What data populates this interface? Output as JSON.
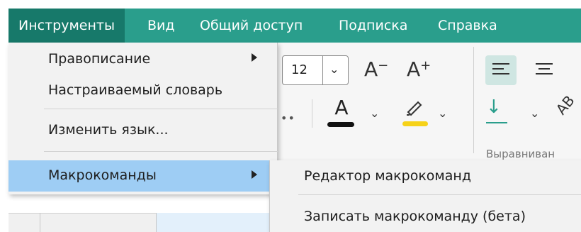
{
  "menubar": {
    "items": [
      {
        "label": "Инструменты",
        "active": true
      },
      {
        "label": "Вид"
      },
      {
        "label": "Общий доступ"
      },
      {
        "label": "Подписка"
      },
      {
        "label": "Справка"
      }
    ],
    "color": "#2a9e8c",
    "active_color": "#17796a"
  },
  "toolbar": {
    "font_size": "12",
    "decrease_font_icon": "A⁻",
    "increase_font_icon": "A⁺",
    "text_color_icon": "A",
    "group_label": "Выравниван"
  },
  "dropdown": {
    "items": [
      {
        "label": "Правописание",
        "has_submenu": true
      },
      {
        "label": "Настраиваемый словарь"
      },
      {
        "label": "Изменить язык..."
      },
      {
        "label": "Макрокоманды",
        "has_submenu": true,
        "highlighted": true
      }
    ],
    "highlight_color": "#9ecdf4"
  },
  "submenu": {
    "items": [
      {
        "label": "Редактор макрокоманд"
      },
      {
        "label": "Записать макрокоманду (бета)"
      }
    ]
  }
}
